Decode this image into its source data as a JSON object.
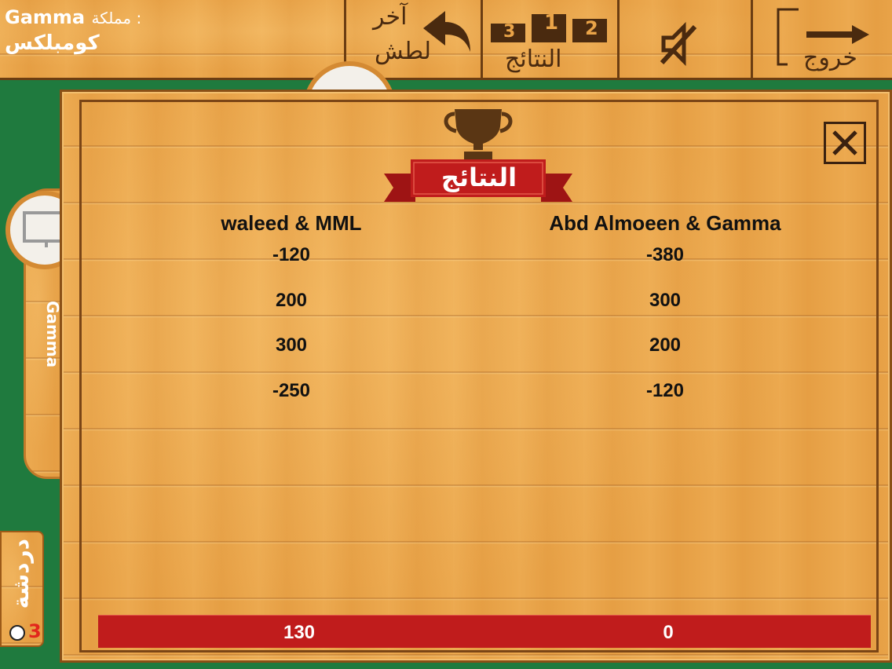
{
  "header": {
    "table_type_label": "مملكة :",
    "table_name": "Gamma",
    "game_mode": "كومبلكس"
  },
  "toolbar": {
    "last_trick_label_1": "آخر",
    "last_trick_label_2": "لطش",
    "results_label": "النتائج",
    "results_ranks": [
      "3",
      "1",
      "2"
    ],
    "exit_label": "خروج"
  },
  "side": {
    "player_name": "Gamma",
    "chat_label": "دردشة",
    "chat_count": "3"
  },
  "results": {
    "title": "النتائج",
    "teams": [
      {
        "name": "waleed & MML",
        "scores": [
          "-120",
          "200",
          "300",
          "-250"
        ],
        "total": "130"
      },
      {
        "name": "Abd Almoeen & Gamma",
        "scores": [
          "-380",
          "300",
          "200",
          "-120"
        ],
        "total": "0"
      }
    ]
  },
  "colors": {
    "felt": "#1f7a3e",
    "wood": "#eaa448",
    "ribbon": "#c01c1c",
    "frame": "#7a4516"
  }
}
